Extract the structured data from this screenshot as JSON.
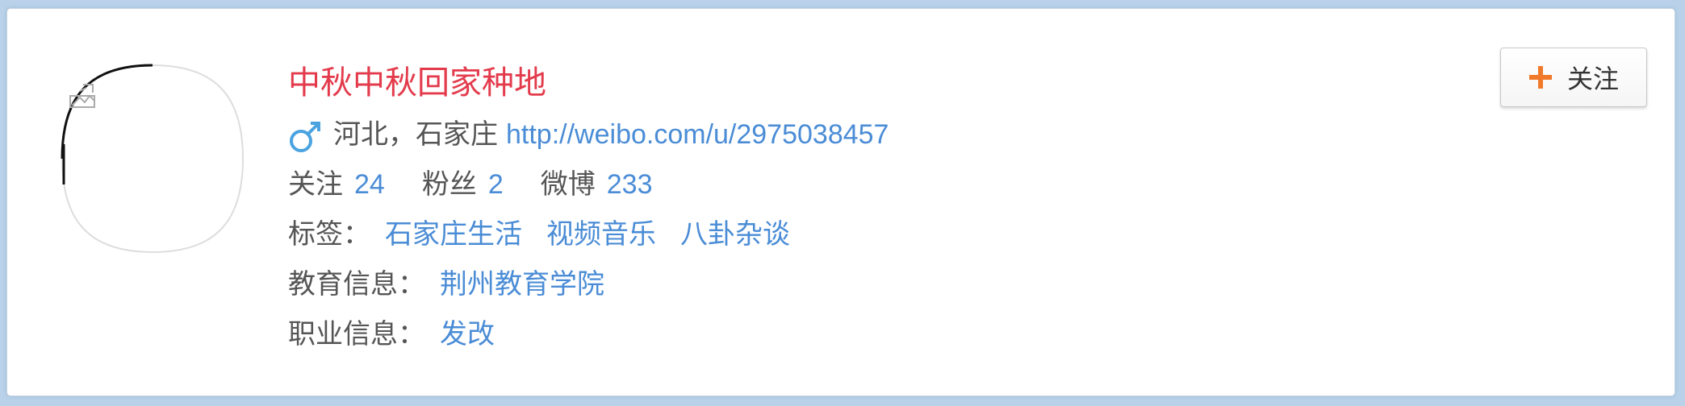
{
  "profile": {
    "name": "中秋中秋回家种地",
    "gender_icon": "male-icon",
    "location": "河北，石家庄",
    "url": "http://weibo.com/u/2975038457",
    "counts": [
      {
        "label": "关注",
        "value": "24"
      },
      {
        "label": "粉丝",
        "value": "2"
      },
      {
        "label": "微博",
        "value": "233"
      }
    ],
    "tags_label": "标签：",
    "tags": [
      "石家庄生活",
      "视频音乐",
      "八卦杂谈"
    ],
    "education_label": "教育信息：",
    "education": "荆州教育学院",
    "job_label": "职业信息：",
    "job": "发改"
  },
  "follow_button": {
    "label": "关注",
    "icon": "plus-icon"
  },
  "colors": {
    "name": "#e33b4c",
    "link": "#4a8cd6",
    "text": "#555555",
    "plus": "#f07a2a",
    "gender": "#4aa3e0"
  }
}
